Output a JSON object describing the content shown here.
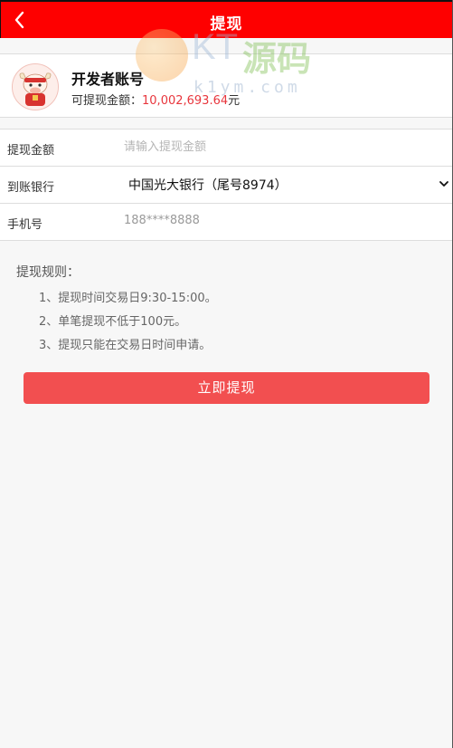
{
  "header": {
    "title": "提现"
  },
  "account": {
    "name": "开发者账号",
    "balance_label": "可提现金额：",
    "balance_amount": "10,002,693.64",
    "balance_unit": "元"
  },
  "watermark": {
    "brand_latin": "KT",
    "brand_cn": "源码",
    "url": "k1ym.com"
  },
  "form": {
    "amount": {
      "label": "提现金额",
      "placeholder": "请输入提现金额",
      "value": ""
    },
    "bank": {
      "label": "到账银行",
      "selected": "中国光大银行（尾号8974）"
    },
    "phone": {
      "label": "手机号",
      "value": "188****8888"
    }
  },
  "rules": {
    "title": "提现规则：",
    "items": [
      "1、提现时间交易日9:30-15:00。",
      "2、单笔提现不低于100元。",
      "3、提现只能在交易日时间申请。"
    ]
  },
  "submit": {
    "label": "立即提现"
  },
  "colors": {
    "header": "#fe0000",
    "button": "#f24f50",
    "amount": "#e8363d"
  },
  "icons": {
    "back": "chevron-left-icon",
    "dropdown": "chevron-down-icon",
    "avatar": "ox-mascot-avatar"
  }
}
